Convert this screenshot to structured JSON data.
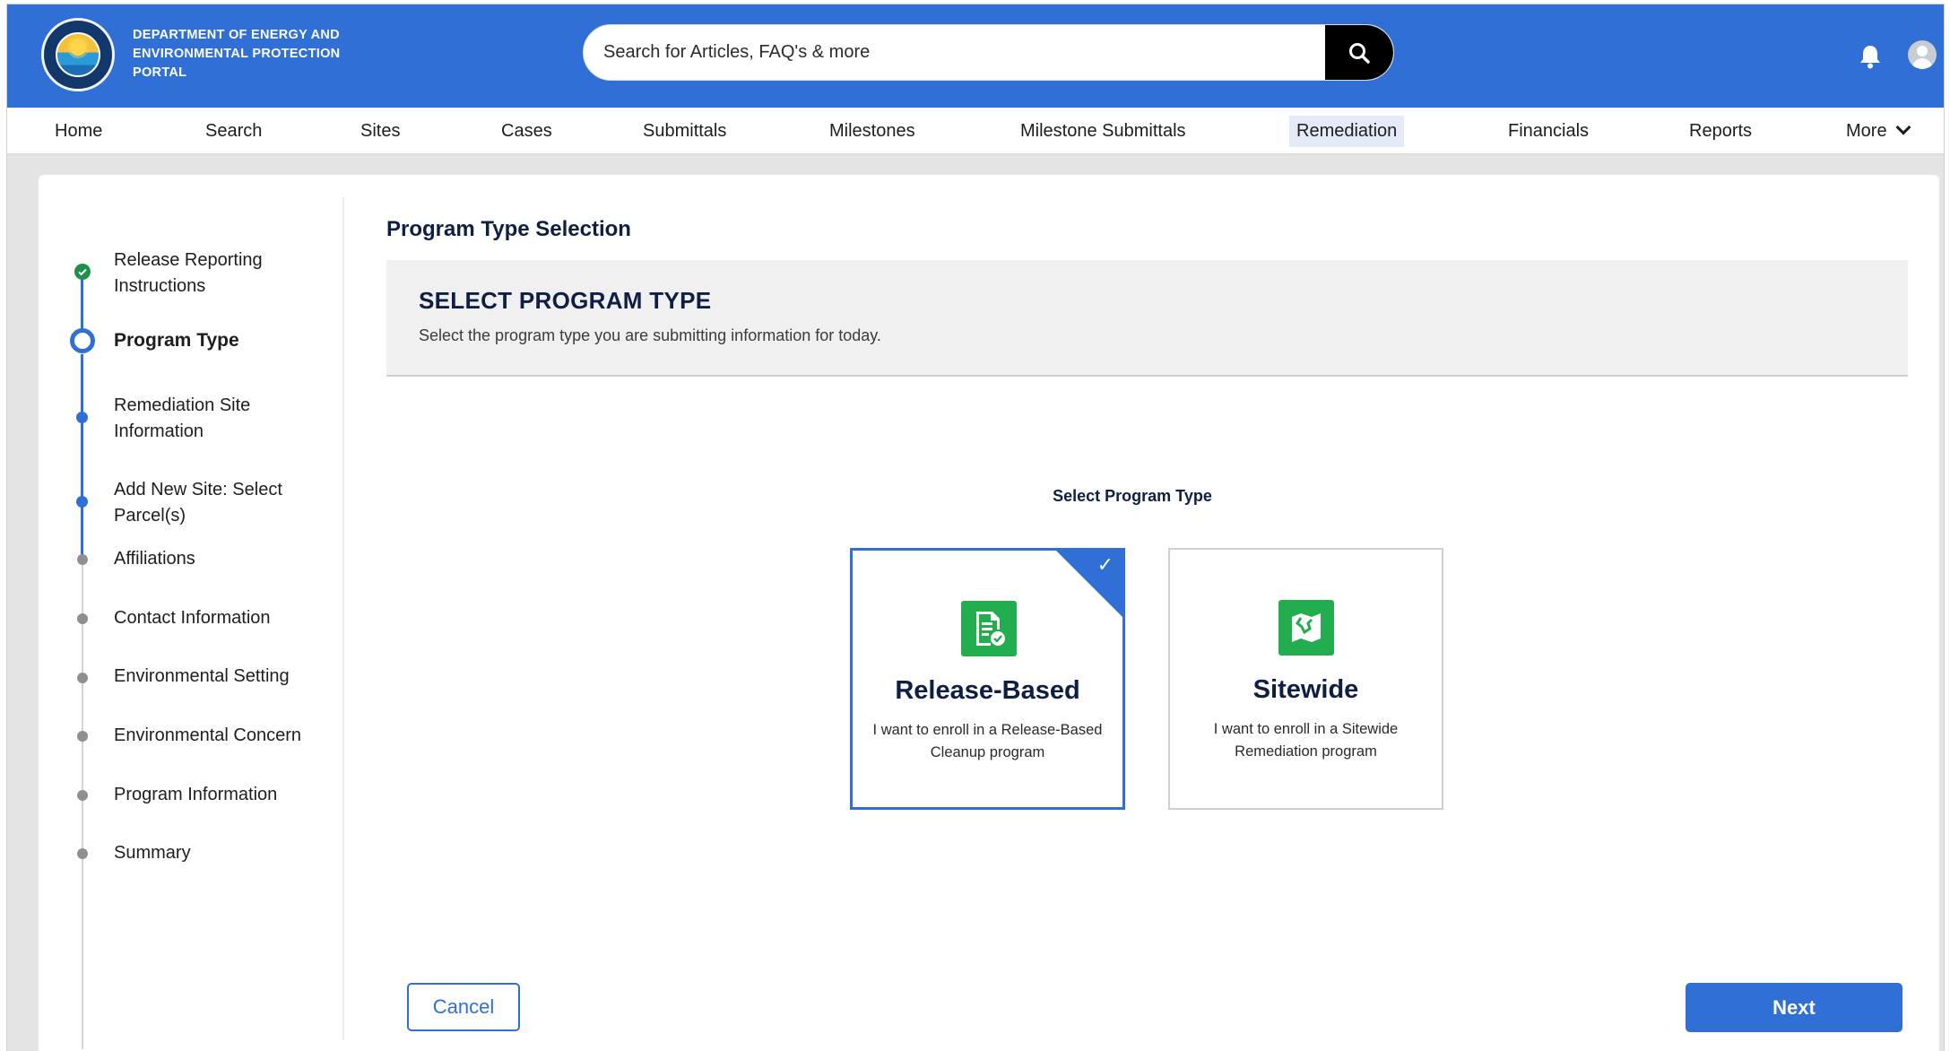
{
  "header": {
    "portal_title": "DEPARTMENT OF ENERGY AND ENVIRONMENTAL PROTECTION PORTAL",
    "search_placeholder": "Search for Articles, FAQ's & more",
    "logo_icon": "state-seal-logo",
    "colors": {
      "brand": "#2f6fd6",
      "search_button": "#000000"
    }
  },
  "nav": {
    "items": [
      {
        "label": "Home"
      },
      {
        "label": "Search"
      },
      {
        "label": "Sites"
      },
      {
        "label": "Cases"
      },
      {
        "label": "Submittals"
      },
      {
        "label": "Milestones"
      },
      {
        "label": "Milestone Submittals"
      },
      {
        "label": "Remediation",
        "active": true
      },
      {
        "label": "Financials"
      },
      {
        "label": "Reports"
      },
      {
        "label": "More"
      }
    ]
  },
  "steps": [
    {
      "label": "Release Reporting Instructions",
      "status": "complete"
    },
    {
      "label": "Program Type",
      "status": "current"
    },
    {
      "label": "Remediation Site Information",
      "status": "pending-active"
    },
    {
      "label": "Add New Site: Select Parcel(s)",
      "status": "pending-active"
    },
    {
      "label": "Affiliations",
      "status": "pending"
    },
    {
      "label": "Contact Information",
      "status": "pending"
    },
    {
      "label": "Environmental Setting",
      "status": "pending"
    },
    {
      "label": "Environmental Concern",
      "status": "pending"
    },
    {
      "label": "Program Information",
      "status": "pending"
    },
    {
      "label": "Summary",
      "status": "pending"
    }
  ],
  "main": {
    "title": "Program Type Selection",
    "banner_heading": "SELECT PROGRAM TYPE",
    "banner_sub": "Select the program type you are submitting information for today.",
    "select_label": "Select Program Type",
    "options": [
      {
        "title": "Release-Based",
        "desc": "I want to enroll in a Release-Based Cleanup program",
        "icon": "document-check-icon",
        "selected": true
      },
      {
        "title": "Sitewide",
        "desc": "I want to enroll in a Sitewide Remediation program",
        "icon": "map-icon",
        "selected": false
      }
    ],
    "cancel_label": "Cancel",
    "next_label": "Next"
  }
}
